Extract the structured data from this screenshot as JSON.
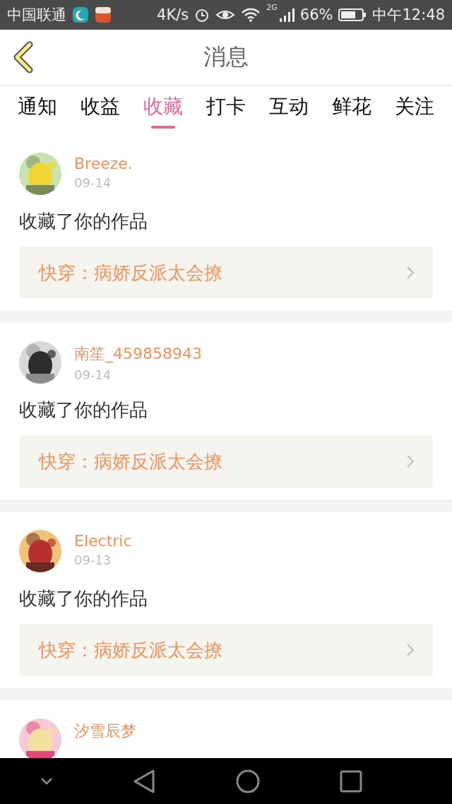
{
  "status_bar": {
    "carrier": "中国联通",
    "net_speed": "4K/s",
    "network": "2G",
    "battery": "66%",
    "time": "中午12:48"
  },
  "header": {
    "title": "消息"
  },
  "tabs": [
    {
      "label": "通知",
      "selected": false
    },
    {
      "label": "收益",
      "selected": false
    },
    {
      "label": "收藏",
      "selected": true
    },
    {
      "label": "打卡",
      "selected": false
    },
    {
      "label": "互动",
      "selected": false
    },
    {
      "label": "鲜花",
      "selected": false
    },
    {
      "label": "关注",
      "selected": false
    }
  ],
  "messages": [
    {
      "user": "Breeze.",
      "date": "09-14",
      "action": "收藏了你的作品",
      "work": "快穿：病娇反派太会撩"
    },
    {
      "user": "南笙_459858943",
      "date": "09-14",
      "action": "收藏了你的作品",
      "work": "快穿：病娇反派太会撩"
    },
    {
      "user": "Electric",
      "date": "09-13",
      "action": "收藏了你的作品",
      "work": "快穿：病娇反派太会撩"
    },
    {
      "user": "汐雪辰梦"
    }
  ]
}
